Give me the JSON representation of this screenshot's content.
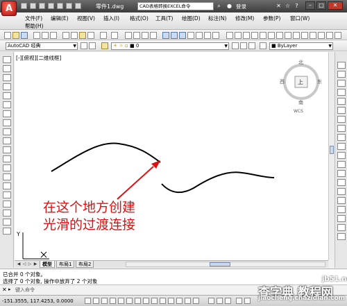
{
  "titlebar": {
    "logo": "A",
    "title": "零件1.dwg",
    "search_value": "CAD表格转换EXCEL命令",
    "login": "登录",
    "icons": [
      "binoculars-icon",
      "star-icon",
      "exchange-icon",
      "help-icon"
    ]
  },
  "menu": {
    "items": [
      "文件(F)",
      "编辑(E)",
      "视图(V)",
      "插入(I)",
      "格式(O)",
      "工具(T)",
      "绘图(D)",
      "标注(N)",
      "修改(M)",
      "参数(P)",
      "窗口(W)",
      "帮助(H)"
    ]
  },
  "toolbar": {
    "workspace": "AutoCAD 经典",
    "layer": "0",
    "color": "ByLayer"
  },
  "viewport": {
    "label": "[-][俯视][二维线框]",
    "viewcube": {
      "top": "上",
      "north": "北",
      "south": "南",
      "west": "西",
      "east": "东",
      "wcs": "WCS"
    },
    "annotation_line1": "在这个地方创建",
    "annotation_line2": "光滑的过渡连接",
    "ucs_y": "Y"
  },
  "tabs": [
    "模型",
    "布局1",
    "布局2"
  ],
  "command": {
    "history_1": "已合并 0 个对象。",
    "history_2": "选择了 0 个对象, 操作中放弃了 2 个对象",
    "input_placeholder": "键入命令"
  },
  "status": {
    "coordinates": "-151.3555, 117.4253, 0.0000"
  },
  "watermark": {
    "line1": "查字典 教程网",
    "line2": "jiaocheng.chazidian.com",
    "domain": "jb51.net"
  },
  "colors": {
    "annotation": "#dd1111",
    "curve": "#000000",
    "titlebar": "#4a4a4a"
  }
}
